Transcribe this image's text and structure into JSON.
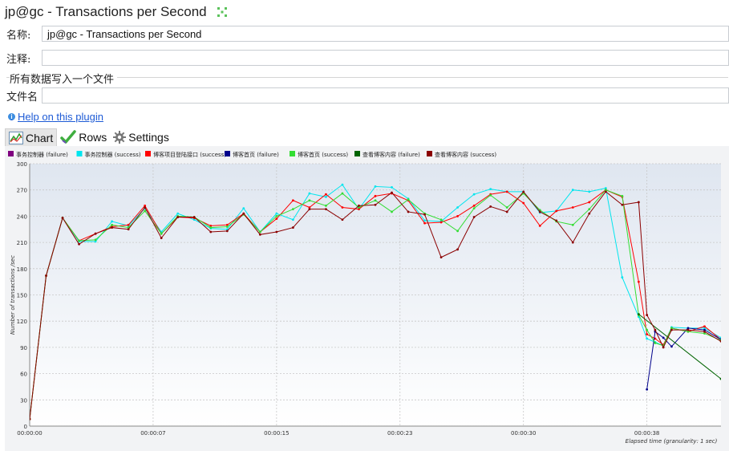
{
  "header": {
    "title": "jp@gc - Transactions per Second"
  },
  "form": {
    "name_label": "名称:",
    "name_value": "jp@gc - Transactions per Second",
    "comment_label": "注释:",
    "comment_value": "",
    "group_label": "所有数据写入一个文件",
    "file_label": "文件名",
    "file_value": ""
  },
  "help_link": "Help on this plugin",
  "tabs": [
    {
      "label": "Chart",
      "icon": "chart-icon"
    },
    {
      "label": "Rows",
      "icon": "checkmark-icon"
    },
    {
      "label": "Settings",
      "icon": "gear-icon"
    }
  ],
  "chart_data": {
    "type": "line",
    "ylabel": "Number of transactions /sec",
    "xlabel": "Elapsed time (granularity: 1 sec)",
    "ylim": [
      0,
      300
    ],
    "xlim": [
      0,
      42
    ],
    "yticks": [
      0,
      30,
      60,
      90,
      120,
      150,
      180,
      210,
      240,
      270,
      300
    ],
    "xticks": [
      {
        "x": 0,
        "label": "00:00:00"
      },
      {
        "x": 7.5,
        "label": "00:00:07"
      },
      {
        "x": 15,
        "label": "00:00:15"
      },
      {
        "x": 22.5,
        "label": "00:00:23"
      },
      {
        "x": 30,
        "label": "00:00:30"
      },
      {
        "x": 37.5,
        "label": "00:00:38"
      }
    ],
    "grid": true,
    "legend_position": "top",
    "series": [
      {
        "name": "事务控制器 (failure)",
        "color": "#800080",
        "x": [],
        "values": []
      },
      {
        "name": "事务控制器 (success)",
        "color": "#00e5ee",
        "x": [
          0,
          1,
          2,
          3,
          4,
          5,
          6,
          7,
          8,
          9,
          10,
          11,
          12,
          13,
          14,
          15,
          16,
          17,
          18,
          19,
          20,
          21,
          22,
          23,
          24,
          25,
          26,
          27,
          28,
          29,
          30,
          31,
          32,
          33,
          34,
          35,
          36,
          37,
          37.5,
          38,
          38.5,
          39,
          40,
          41,
          42
        ],
        "values": [
          8,
          172,
          238,
          211,
          211,
          234,
          229,
          249,
          222,
          243,
          236,
          226,
          225,
          249,
          222,
          243,
          236,
          266,
          262,
          276,
          248,
          274,
          273,
          260,
          235,
          234,
          250,
          265,
          271,
          268,
          268,
          244,
          246,
          270,
          268,
          272,
          170,
          125,
          100,
          96,
          92,
          113,
          112,
          112,
          101
        ]
      },
      {
        "name": "博客项目登陆接口 (success)",
        "color": "#ff0000",
        "x": [
          0,
          1,
          2,
          3,
          4,
          5,
          6,
          7,
          8,
          9,
          10,
          11,
          12,
          13,
          14,
          15,
          16,
          17,
          18,
          19,
          20,
          21,
          22,
          23,
          24,
          25,
          26,
          27,
          28,
          29,
          30,
          31,
          32,
          33,
          34,
          35,
          36,
          37,
          37.5,
          38,
          38.5,
          39,
          40,
          41,
          42
        ],
        "values": [
          8,
          172,
          238,
          212,
          220,
          228,
          230,
          252,
          220,
          239,
          238,
          229,
          230,
          243,
          222,
          237,
          258,
          250,
          265,
          250,
          248,
          263,
          266,
          258,
          232,
          233,
          240,
          252,
          265,
          268,
          255,
          229,
          246,
          250,
          256,
          270,
          262,
          165,
          105,
          100,
          93,
          112,
          108,
          114,
          99
        ]
      },
      {
        "name": "博客首页 (failure)",
        "color": "#00008b",
        "x": [
          37.5,
          38,
          38.5,
          39,
          40,
          41,
          42
        ],
        "values": [
          42,
          108,
          101,
          91,
          112,
          110,
          99
        ]
      },
      {
        "name": "博客首页 (success)",
        "color": "#33dd33",
        "x": [
          0,
          1,
          2,
          3,
          4,
          5,
          6,
          7,
          8,
          9,
          10,
          11,
          12,
          13,
          14,
          15,
          16,
          17,
          18,
          19,
          20,
          21,
          22,
          23,
          24,
          25,
          26,
          27,
          28,
          29,
          30,
          31,
          32,
          33,
          34,
          35,
          36,
          37,
          37.5,
          38,
          38.5,
          39,
          40,
          41,
          42
        ],
        "values": [
          8,
          172,
          238,
          212,
          213,
          230,
          227,
          246,
          220,
          240,
          239,
          227,
          228,
          242,
          222,
          240,
          248,
          258,
          252,
          266,
          250,
          258,
          245,
          259,
          243,
          236,
          223,
          249,
          264,
          250,
          266,
          247,
          234,
          230,
          248,
          270,
          263,
          127,
          110,
          95,
          92,
          112,
          108,
          106,
          98
        ]
      },
      {
        "name": "查看博客内容 (failure)",
        "color": "#006400",
        "x": [
          37,
          42
        ],
        "values": [
          128,
          54
        ]
      },
      {
        "name": "查看博客内容 (success)",
        "color": "#8b0000",
        "x": [
          0,
          1,
          2,
          3,
          4,
          5,
          6,
          7,
          8,
          9,
          10,
          11,
          12,
          13,
          14,
          15,
          16,
          17,
          18,
          19,
          20,
          21,
          22,
          23,
          24,
          25,
          26,
          27,
          28,
          29,
          30,
          31,
          32,
          33,
          34,
          35,
          36,
          37,
          37.5,
          38,
          38.5,
          39,
          40,
          41,
          42
        ],
        "values": [
          8,
          172,
          238,
          208,
          220,
          227,
          225,
          250,
          215,
          239,
          239,
          222,
          223,
          243,
          219,
          222,
          227,
          248,
          248,
          236,
          252,
          253,
          267,
          245,
          242,
          193,
          202,
          239,
          251,
          245,
          268,
          245,
          235,
          210,
          243,
          268,
          253,
          256,
          127,
          110,
          90,
          110,
          110,
          108,
          97
        ]
      }
    ]
  }
}
